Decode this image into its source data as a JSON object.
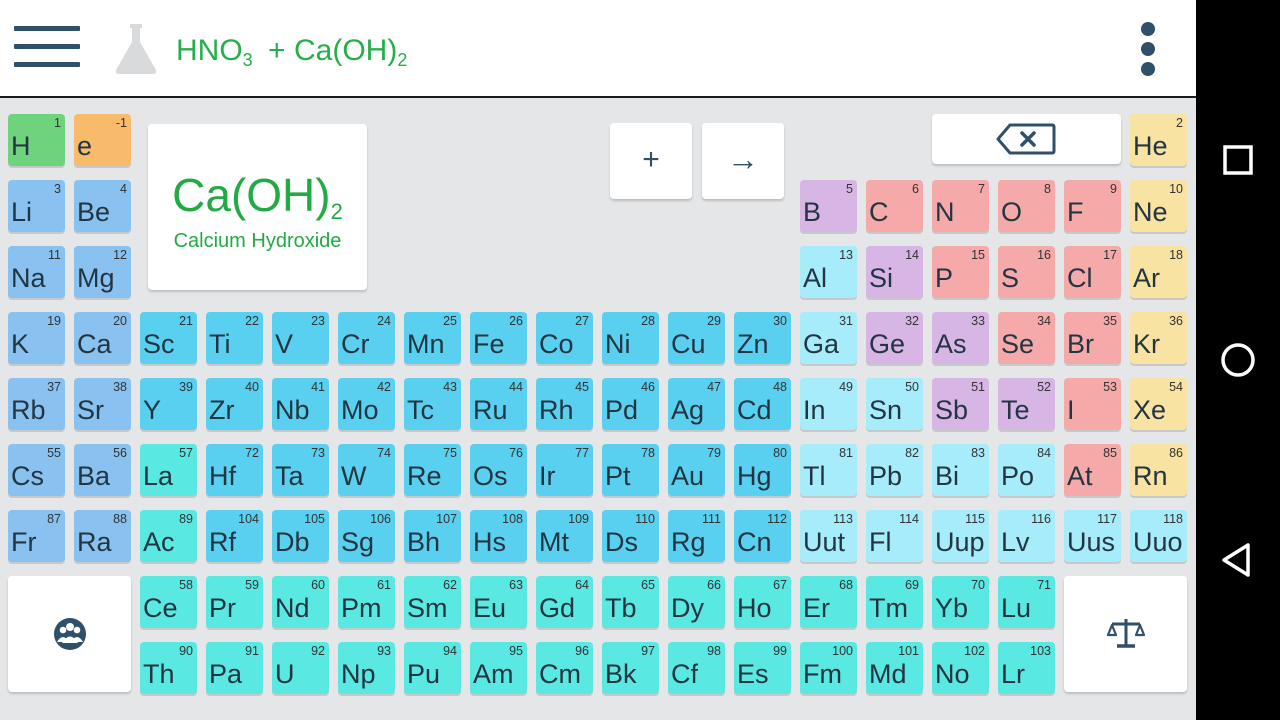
{
  "equation": {
    "r1_base": "HNO",
    "r1_sub": "3",
    "plus": "+",
    "r2_base": "Ca(OH)",
    "r2_sub": "2"
  },
  "compound": {
    "formula_base": "Ca(OH)",
    "formula_sub": "2",
    "name": "Calcium Hydroxide"
  },
  "keys": {
    "plus": "+",
    "arrow": "→"
  },
  "icons": {
    "menu": "hamburger-menu-icon",
    "flask": "flask-icon",
    "more": "more-vert-icon",
    "backspace": "backspace-icon",
    "group": "group-icon",
    "balance": "balance-scale-icon",
    "nav_square": "recent-apps-icon",
    "nav_circle": "home-icon",
    "nav_triangle": "back-icon"
  },
  "colors": {
    "accent_green": "#27ae4b",
    "icon_dark": "#2f4f6b",
    "alkali": "#89c1f0",
    "transition": "#5ad0f0",
    "post_transition": "#a6ecfa",
    "lanthanide_actinide": "#5ae8e2",
    "metalloid": "#d7b6e6",
    "nonmetal": "#f6a9a9",
    "noble": "#f8e3a2",
    "hydrogen": "#6fd37e",
    "electron": "#f7bb6b"
  },
  "elements": [
    {
      "sym": "H",
      "num": "1",
      "cat": "hydrogen"
    },
    {
      "sym": "e",
      "num": "-1",
      "cat": "electron"
    },
    {
      "sym": "He",
      "num": "2",
      "cat": "noble"
    },
    {
      "sym": "Li",
      "num": "3",
      "cat": "alkali"
    },
    {
      "sym": "Be",
      "num": "4",
      "cat": "alkali"
    },
    {
      "sym": "B",
      "num": "5",
      "cat": "metalloid"
    },
    {
      "sym": "C",
      "num": "6",
      "cat": "nonmetal"
    },
    {
      "sym": "N",
      "num": "7",
      "cat": "nonmetal"
    },
    {
      "sym": "O",
      "num": "8",
      "cat": "nonmetal"
    },
    {
      "sym": "F",
      "num": "9",
      "cat": "nonmetal"
    },
    {
      "sym": "Ne",
      "num": "10",
      "cat": "noble"
    },
    {
      "sym": "Na",
      "num": "11",
      "cat": "alkali"
    },
    {
      "sym": "Mg",
      "num": "12",
      "cat": "alkali"
    },
    {
      "sym": "Al",
      "num": "13",
      "cat": "post_transition"
    },
    {
      "sym": "Si",
      "num": "14",
      "cat": "metalloid"
    },
    {
      "sym": "P",
      "num": "15",
      "cat": "nonmetal"
    },
    {
      "sym": "S",
      "num": "16",
      "cat": "nonmetal"
    },
    {
      "sym": "Cl",
      "num": "17",
      "cat": "nonmetal"
    },
    {
      "sym": "Ar",
      "num": "18",
      "cat": "noble"
    },
    {
      "sym": "K",
      "num": "19",
      "cat": "alkali"
    },
    {
      "sym": "Ca",
      "num": "20",
      "cat": "alkali"
    },
    {
      "sym": "Sc",
      "num": "21",
      "cat": "transition"
    },
    {
      "sym": "Ti",
      "num": "22",
      "cat": "transition"
    },
    {
      "sym": "V",
      "num": "23",
      "cat": "transition"
    },
    {
      "sym": "Cr",
      "num": "24",
      "cat": "transition"
    },
    {
      "sym": "Mn",
      "num": "25",
      "cat": "transition"
    },
    {
      "sym": "Fe",
      "num": "26",
      "cat": "transition"
    },
    {
      "sym": "Co",
      "num": "27",
      "cat": "transition"
    },
    {
      "sym": "Ni",
      "num": "28",
      "cat": "transition"
    },
    {
      "sym": "Cu",
      "num": "29",
      "cat": "transition"
    },
    {
      "sym": "Zn",
      "num": "30",
      "cat": "transition"
    },
    {
      "sym": "Ga",
      "num": "31",
      "cat": "post_transition"
    },
    {
      "sym": "Ge",
      "num": "32",
      "cat": "metalloid"
    },
    {
      "sym": "As",
      "num": "33",
      "cat": "metalloid"
    },
    {
      "sym": "Se",
      "num": "34",
      "cat": "nonmetal"
    },
    {
      "sym": "Br",
      "num": "35",
      "cat": "nonmetal"
    },
    {
      "sym": "Kr",
      "num": "36",
      "cat": "noble"
    },
    {
      "sym": "Rb",
      "num": "37",
      "cat": "alkali"
    },
    {
      "sym": "Sr",
      "num": "38",
      "cat": "alkali"
    },
    {
      "sym": "Y",
      "num": "39",
      "cat": "transition"
    },
    {
      "sym": "Zr",
      "num": "40",
      "cat": "transition"
    },
    {
      "sym": "Nb",
      "num": "41",
      "cat": "transition"
    },
    {
      "sym": "Mo",
      "num": "42",
      "cat": "transition"
    },
    {
      "sym": "Tc",
      "num": "43",
      "cat": "transition"
    },
    {
      "sym": "Ru",
      "num": "44",
      "cat": "transition"
    },
    {
      "sym": "Rh",
      "num": "45",
      "cat": "transition"
    },
    {
      "sym": "Pd",
      "num": "46",
      "cat": "transition"
    },
    {
      "sym": "Ag",
      "num": "47",
      "cat": "transition"
    },
    {
      "sym": "Cd",
      "num": "48",
      "cat": "transition"
    },
    {
      "sym": "In",
      "num": "49",
      "cat": "post_transition"
    },
    {
      "sym": "Sn",
      "num": "50",
      "cat": "post_transition"
    },
    {
      "sym": "Sb",
      "num": "51",
      "cat": "metalloid"
    },
    {
      "sym": "Te",
      "num": "52",
      "cat": "metalloid"
    },
    {
      "sym": "I",
      "num": "53",
      "cat": "nonmetal"
    },
    {
      "sym": "Xe",
      "num": "54",
      "cat": "noble"
    },
    {
      "sym": "Cs",
      "num": "55",
      "cat": "alkali"
    },
    {
      "sym": "Ba",
      "num": "56",
      "cat": "alkali"
    },
    {
      "sym": "La",
      "num": "57",
      "cat": "lanthanide_actinide"
    },
    {
      "sym": "Hf",
      "num": "72",
      "cat": "transition"
    },
    {
      "sym": "Ta",
      "num": "73",
      "cat": "transition"
    },
    {
      "sym": "W",
      "num": "74",
      "cat": "transition"
    },
    {
      "sym": "Re",
      "num": "75",
      "cat": "transition"
    },
    {
      "sym": "Os",
      "num": "76",
      "cat": "transition"
    },
    {
      "sym": "Ir",
      "num": "77",
      "cat": "transition"
    },
    {
      "sym": "Pt",
      "num": "78",
      "cat": "transition"
    },
    {
      "sym": "Au",
      "num": "79",
      "cat": "transition"
    },
    {
      "sym": "Hg",
      "num": "80",
      "cat": "transition"
    },
    {
      "sym": "Tl",
      "num": "81",
      "cat": "post_transition"
    },
    {
      "sym": "Pb",
      "num": "82",
      "cat": "post_transition"
    },
    {
      "sym": "Bi",
      "num": "83",
      "cat": "post_transition"
    },
    {
      "sym": "Po",
      "num": "84",
      "cat": "post_transition"
    },
    {
      "sym": "At",
      "num": "85",
      "cat": "nonmetal"
    },
    {
      "sym": "Rn",
      "num": "86",
      "cat": "noble"
    },
    {
      "sym": "Fr",
      "num": "87",
      "cat": "alkali"
    },
    {
      "sym": "Ra",
      "num": "88",
      "cat": "alkali"
    },
    {
      "sym": "Ac",
      "num": "89",
      "cat": "lanthanide_actinide"
    },
    {
      "sym": "Rf",
      "num": "104",
      "cat": "transition"
    },
    {
      "sym": "Db",
      "num": "105",
      "cat": "transition"
    },
    {
      "sym": "Sg",
      "num": "106",
      "cat": "transition"
    },
    {
      "sym": "Bh",
      "num": "107",
      "cat": "transition"
    },
    {
      "sym": "Hs",
      "num": "108",
      "cat": "transition"
    },
    {
      "sym": "Mt",
      "num": "109",
      "cat": "transition"
    },
    {
      "sym": "Ds",
      "num": "110",
      "cat": "transition"
    },
    {
      "sym": "Rg",
      "num": "111",
      "cat": "transition"
    },
    {
      "sym": "Cn",
      "num": "112",
      "cat": "transition"
    },
    {
      "sym": "Uut",
      "num": "113",
      "cat": "post_transition"
    },
    {
      "sym": "Fl",
      "num": "114",
      "cat": "post_transition"
    },
    {
      "sym": "Uup",
      "num": "115",
      "cat": "post_transition"
    },
    {
      "sym": "Lv",
      "num": "116",
      "cat": "post_transition"
    },
    {
      "sym": "Uus",
      "num": "117",
      "cat": "post_transition"
    },
    {
      "sym": "Uuo",
      "num": "118",
      "cat": "post_transition"
    },
    {
      "sym": "Ce",
      "num": "58",
      "cat": "lanthanide_actinide"
    },
    {
      "sym": "Pr",
      "num": "59",
      "cat": "lanthanide_actinide"
    },
    {
      "sym": "Nd",
      "num": "60",
      "cat": "lanthanide_actinide"
    },
    {
      "sym": "Pm",
      "num": "61",
      "cat": "lanthanide_actinide"
    },
    {
      "sym": "Sm",
      "num": "62",
      "cat": "lanthanide_actinide"
    },
    {
      "sym": "Eu",
      "num": "63",
      "cat": "lanthanide_actinide"
    },
    {
      "sym": "Gd",
      "num": "64",
      "cat": "lanthanide_actinide"
    },
    {
      "sym": "Tb",
      "num": "65",
      "cat": "lanthanide_actinide"
    },
    {
      "sym": "Dy",
      "num": "66",
      "cat": "lanthanide_actinide"
    },
    {
      "sym": "Ho",
      "num": "67",
      "cat": "lanthanide_actinide"
    },
    {
      "sym": "Er",
      "num": "68",
      "cat": "lanthanide_actinide"
    },
    {
      "sym": "Tm",
      "num": "69",
      "cat": "lanthanide_actinide"
    },
    {
      "sym": "Yb",
      "num": "70",
      "cat": "lanthanide_actinide"
    },
    {
      "sym": "Lu",
      "num": "71",
      "cat": "lanthanide_actinide"
    },
    {
      "sym": "Th",
      "num": "90",
      "cat": "lanthanide_actinide"
    },
    {
      "sym": "Pa",
      "num": "91",
      "cat": "lanthanide_actinide"
    },
    {
      "sym": "U",
      "num": "92",
      "cat": "lanthanide_actinide"
    },
    {
      "sym": "Np",
      "num": "93",
      "cat": "lanthanide_actinide"
    },
    {
      "sym": "Pu",
      "num": "94",
      "cat": "lanthanide_actinide"
    },
    {
      "sym": "Am",
      "num": "95",
      "cat": "lanthanide_actinide"
    },
    {
      "sym": "Cm",
      "num": "96",
      "cat": "lanthanide_actinide"
    },
    {
      "sym": "Bk",
      "num": "97",
      "cat": "lanthanide_actinide"
    },
    {
      "sym": "Cf",
      "num": "98",
      "cat": "lanthanide_actinide"
    },
    {
      "sym": "Es",
      "num": "99",
      "cat": "lanthanide_actinide"
    },
    {
      "sym": "Fm",
      "num": "100",
      "cat": "lanthanide_actinide"
    },
    {
      "sym": "Md",
      "num": "101",
      "cat": "lanthanide_actinide"
    },
    {
      "sym": "No",
      "num": "102",
      "cat": "lanthanide_actinide"
    },
    {
      "sym": "Lr",
      "num": "103",
      "cat": "lanthanide_actinide"
    }
  ]
}
